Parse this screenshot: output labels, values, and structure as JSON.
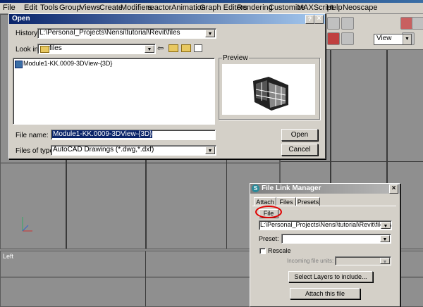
{
  "menu": [
    "File",
    "Edit",
    "Tools",
    "Group",
    "Views",
    "Create",
    "Modifiers",
    "reactor",
    "Animation",
    "Graph Editors",
    "Rendering",
    "Customize",
    "MAXScript",
    "Help",
    "Neoscape"
  ],
  "toolbar": {
    "view_dropdown": "View"
  },
  "viewports": {
    "left_label": "Left"
  },
  "open_dialog": {
    "title": "Open",
    "help_btn": "?",
    "close_btn": "×",
    "history_label": "History:",
    "history_value": "L:\\Personal_Projects\\Nensi\\tutorial\\Revit\\files",
    "lookin_label": "Look in:",
    "lookin_value": "files",
    "file_item": "Module1-KK.0009-3DView-{3D}",
    "preview_label": "Preview",
    "filename_label": "File name:",
    "filename_value": "Module1-KK.0009-3DView-{3D}",
    "filetype_label": "Files of type:",
    "filetype_value": "AutoCAD Drawings (*.dwg,*.dxf)",
    "open_btn": "Open",
    "cancel_btn": "Cancel"
  },
  "file_link_manager": {
    "title": "File Link Manager",
    "close_btn": "×",
    "tabs": [
      "Attach",
      "Files",
      "Presets"
    ],
    "subtab": "File",
    "path_value": "L:\\Personal_Projects\\Nensi\\tutorial\\Revit\\files\\Mod",
    "preset_label": "Preset:",
    "rescale_label": "Rescale",
    "incoming_units_label": "Incoming file units:",
    "select_layers_btn": "Select Layers to include...",
    "attach_btn": "Attach this file"
  },
  "colors": {
    "title_active": "#0a246a",
    "title_active_end": "#a6caf0",
    "highlight_circle": "#e00000",
    "selection": "#0a246a"
  }
}
